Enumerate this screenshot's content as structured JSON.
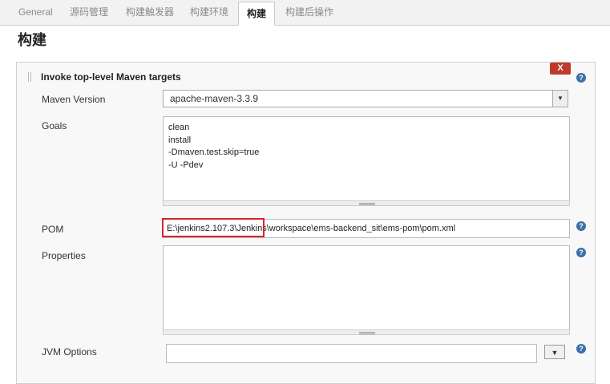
{
  "tabs": [
    {
      "label": "General"
    },
    {
      "label": "源码管理"
    },
    {
      "label": "构建触发器"
    },
    {
      "label": "构建环境"
    },
    {
      "label": "构建"
    },
    {
      "label": "构建后操作"
    }
  ],
  "page_title": "构建",
  "step": {
    "title": "Invoke top-level Maven targets",
    "delete_label": "X",
    "help_glyph": "?"
  },
  "fields": {
    "maven_version": {
      "label": "Maven Version",
      "value": "apache-maven-3.3.9"
    },
    "goals": {
      "label": "Goals",
      "value": "clean\ninstall\n-Dmaven.test.skip=true\n-U -Pdev"
    },
    "pom": {
      "label": "POM",
      "value": "E:\\jenkins2.107.3\\Jenkins\\workspace\\ems-backend_sit\\ems-pom\\pom.xml"
    },
    "properties": {
      "label": "Properties",
      "value": ""
    },
    "jvm_options": {
      "label": "JVM Options",
      "value": ""
    }
  },
  "icons": {
    "dropdown": "▼"
  },
  "colors": {
    "accent": "#3d6fa8",
    "delete": "#c0392b",
    "highlight": "#d9232d"
  }
}
